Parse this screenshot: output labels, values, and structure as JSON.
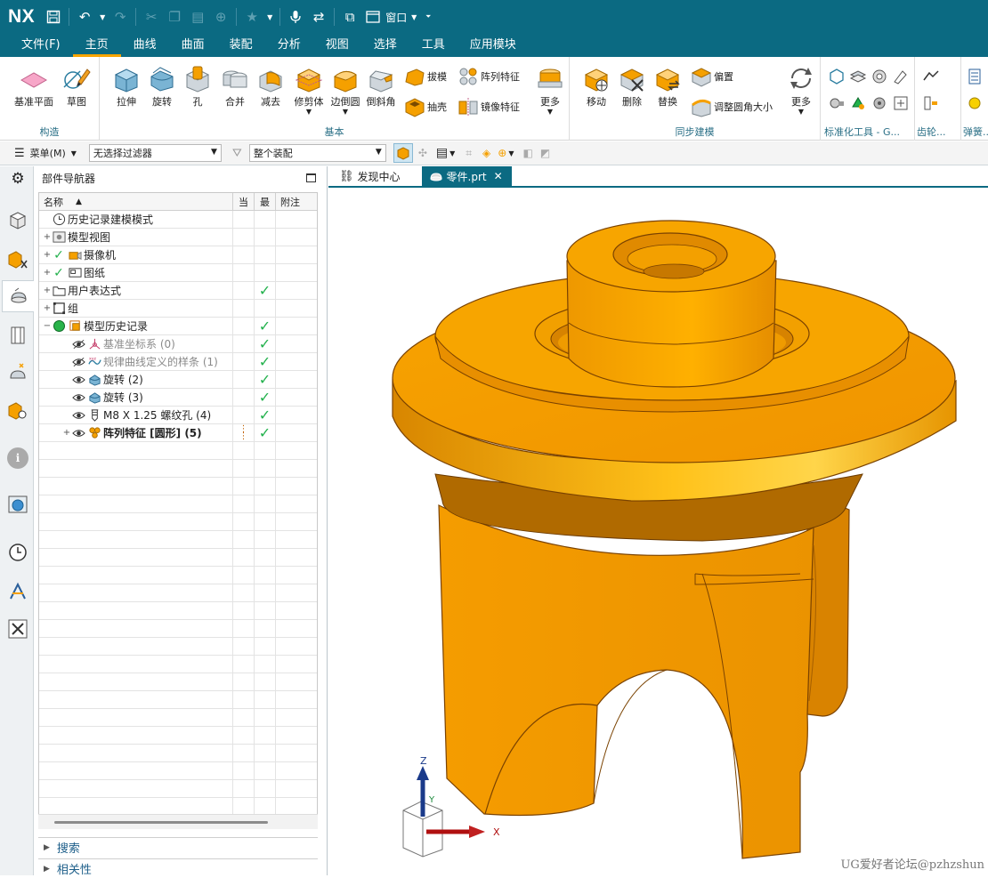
{
  "app": {
    "logo": "NX"
  },
  "quick_access": {
    "window_label": "窗口"
  },
  "menu": {
    "items": [
      "文件(F)",
      "主页",
      "曲线",
      "曲面",
      "装配",
      "分析",
      "视图",
      "选择",
      "工具",
      "应用模块"
    ],
    "active": "主页"
  },
  "ribbon": {
    "construct": {
      "label": "构造",
      "datum_plane": "基准平面",
      "sketch": "草图"
    },
    "basic": {
      "label": "基本",
      "extrude": "拉伸",
      "revolve": "旋转",
      "hole": "孔",
      "unite": "合并",
      "subtract": "减去",
      "trim_body": "修剪体",
      "edge_blend": "边倒圆",
      "chamfer": "倒斜角",
      "draft": "拔模",
      "shell": "抽壳",
      "pattern_feature": "阵列特征",
      "mirror_feature": "镜像特征",
      "more": "更多"
    },
    "sync": {
      "label": "同步建模",
      "move": "移动",
      "delete": "删除",
      "replace": "替换",
      "offset": "偏置",
      "resize_blend": "调整圆角大小",
      "more": "更多"
    },
    "standard_tools": {
      "label": "标准化工具 - G..."
    },
    "gear": {
      "label": "齿轮..."
    },
    "spring": {
      "label": "弹簧..."
    }
  },
  "filter_bar": {
    "menu_label": "菜单(M)",
    "type_filter": "无选择过滤器",
    "scope": "整个装配"
  },
  "navigator": {
    "title": "部件导航器",
    "columns": {
      "name": "名称",
      "current": "当",
      "latest": "最",
      "notes": "附注"
    },
    "rows": [
      {
        "label": "历史记录建模模式",
        "indent": 0,
        "expander": "",
        "check": false,
        "grey": false,
        "bold": false,
        "icon": "clock-icon"
      },
      {
        "label": "模型视图",
        "indent": 0,
        "expander": "+",
        "check": false,
        "grey": false,
        "bold": false,
        "icon": "model-views-icon"
      },
      {
        "label": "摄像机",
        "indent": 0,
        "expander": "+",
        "check": false,
        "tick_before": true,
        "grey": false,
        "bold": false,
        "icon": "camera-icon"
      },
      {
        "label": "图纸",
        "indent": 0,
        "expander": "+",
        "check": false,
        "tick_before": true,
        "grey": false,
        "bold": false,
        "icon": "drawing-icon"
      },
      {
        "label": "用户表达式",
        "indent": 0,
        "expander": "+",
        "check": true,
        "grey": false,
        "bold": false,
        "icon": "folder-icon"
      },
      {
        "label": "组",
        "indent": 0,
        "expander": "+",
        "check": false,
        "grey": false,
        "bold": false,
        "icon": "group-icon"
      },
      {
        "label": "模型历史记录",
        "indent": 0,
        "expander": "-",
        "check": true,
        "grey": false,
        "bold": false,
        "icon": "model-history-icon"
      },
      {
        "label": "基准坐标系 (0)",
        "indent": 1,
        "expander": "",
        "check": true,
        "grey": true,
        "bold": false,
        "icon": "datum-csys-icon"
      },
      {
        "label": "规律曲线定义的样条 (1)",
        "indent": 1,
        "expander": "",
        "check": true,
        "grey": true,
        "bold": false,
        "icon": "law-spline-icon"
      },
      {
        "label": "旋转 (2)",
        "indent": 1,
        "expander": "",
        "check": true,
        "grey": false,
        "bold": false,
        "icon": "revolve-icon"
      },
      {
        "label": "旋转 (3)",
        "indent": 1,
        "expander": "",
        "check": true,
        "grey": false,
        "bold": false,
        "icon": "revolve-icon"
      },
      {
        "label": "M8 X 1.25 螺纹孔 (4)",
        "indent": 1,
        "expander": "",
        "check": true,
        "grey": false,
        "bold": false,
        "icon": "threaded-hole-icon"
      },
      {
        "label": "阵列特征 [圆形] (5)",
        "indent": 1,
        "expander": "+",
        "check": true,
        "grey": false,
        "bold": true,
        "icon": "pattern-icon",
        "current_marker": true
      }
    ],
    "search_label": "搜索",
    "dependencies_label": "相关性"
  },
  "tabs": [
    {
      "label": "发现中心",
      "active": false
    },
    {
      "label": "零件.prt",
      "active": true
    }
  ],
  "viewport": {
    "axis_x": "X",
    "axis_y": "Y",
    "axis_z": "Z",
    "part_color": "#f5a000",
    "watermark": "UG爱好者论坛@pzhzshun"
  }
}
